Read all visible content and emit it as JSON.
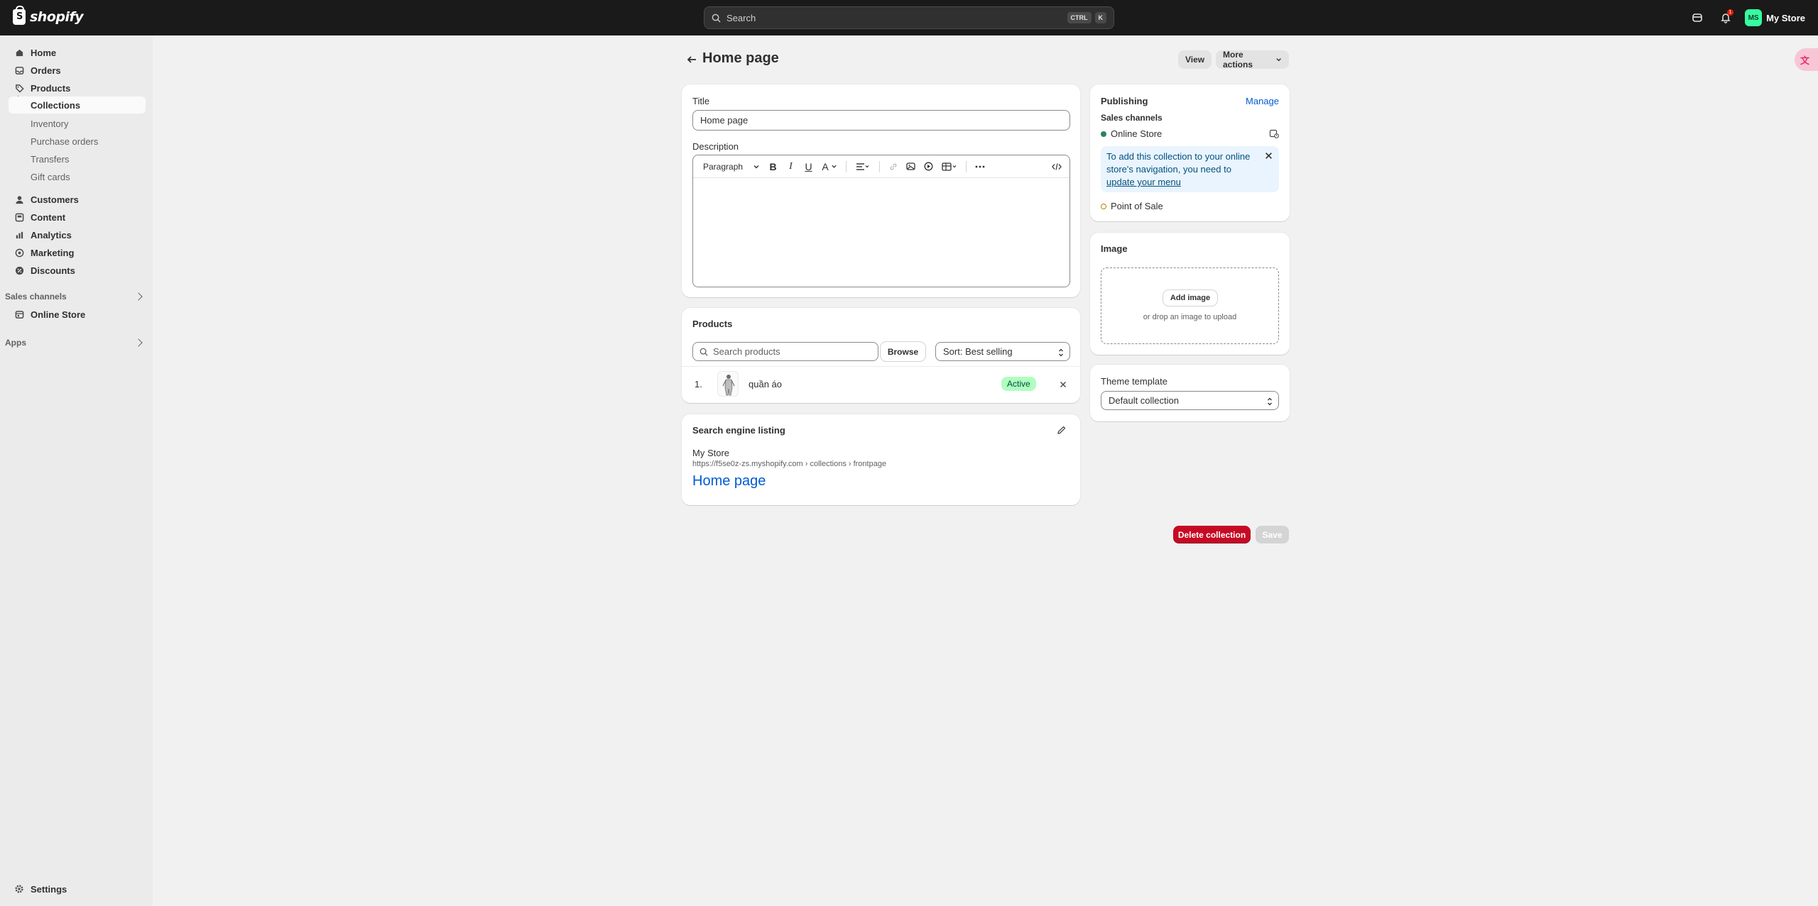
{
  "app": {
    "logo_text": "shopify",
    "store_name": "My Store",
    "avatar_initials": "MS",
    "notification_count": "1"
  },
  "search": {
    "placeholder": "Search",
    "shortcut_1": "CTRL",
    "shortcut_2": "K"
  },
  "sidebar": {
    "items": [
      {
        "label": "Home",
        "icon": "home-icon"
      },
      {
        "label": "Orders",
        "icon": "inbox-icon"
      },
      {
        "label": "Products",
        "icon": "tag-icon"
      },
      {
        "label": "Collections"
      },
      {
        "label": "Inventory"
      },
      {
        "label": "Purchase orders"
      },
      {
        "label": "Transfers"
      },
      {
        "label": "Gift cards"
      },
      {
        "label": "Customers",
        "icon": "person-icon"
      },
      {
        "label": "Content",
        "icon": "content-icon"
      },
      {
        "label": "Analytics",
        "icon": "chart-icon"
      },
      {
        "label": "Marketing",
        "icon": "target-icon"
      },
      {
        "label": "Discounts",
        "icon": "discount-icon"
      }
    ],
    "sales_channels_heading": "Sales channels",
    "online_store": "Online Store",
    "apps_heading": "Apps",
    "settings": "Settings"
  },
  "page": {
    "title": "Home page",
    "view_button": "View",
    "more_actions_button": "More actions"
  },
  "title_card": {
    "title_label": "Title",
    "title_value": "Home page",
    "description_label": "Description",
    "paragraph_select": "Paragraph"
  },
  "products_card": {
    "heading": "Products",
    "search_placeholder": "Search products",
    "browse_button": "Browse",
    "sort_label": "Sort: Best selling",
    "rows": [
      {
        "index": "1.",
        "name": "quần áo",
        "status": "Active"
      }
    ]
  },
  "seo_card": {
    "heading": "Search engine listing",
    "store": "My Store",
    "url": "https://f5se0z-zs.myshopify.com › collections › frontpage",
    "page_title": "Home page"
  },
  "publishing_card": {
    "heading": "Publishing",
    "manage_link": "Manage",
    "sales_channels_label": "Sales channels",
    "online_store": "Online Store",
    "notice_text": "To add this collection to your online store's navigation, you need to ",
    "notice_link": "update your menu",
    "point_of_sale": "Point of Sale"
  },
  "image_card": {
    "heading": "Image",
    "add_button": "Add image",
    "hint": "or drop an image to upload"
  },
  "theme_card": {
    "heading": "Theme template",
    "value": "Default collection"
  },
  "footer": {
    "delete_button": "Delete collection",
    "save_button": "Save"
  },
  "colors": {
    "topbar": "#1a1a1a",
    "danger": "#c70a24",
    "link": "#005bd3",
    "active_badge": "#affebf",
    "avatar": "#36fba1"
  }
}
